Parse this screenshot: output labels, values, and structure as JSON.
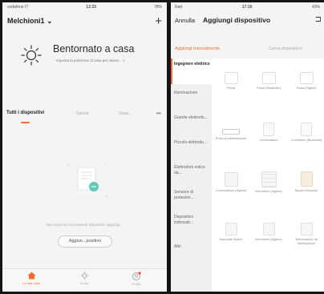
{
  "left": {
    "status": {
      "carrier": "vodafone IT",
      "time": "12:33",
      "battery": "78%"
    },
    "home_name": "Melchioni1 ⌄",
    "welcome_title": "Bentornato a casa",
    "welcome_sub": "Imposta la posizione di casa per ottene... >",
    "tabs": {
      "all": "Tutti i dispositivi",
      "room1": "Salone",
      "room2": "Stanz..."
    },
    "empty_text": "Non sono ancora presenti dispositivi, aggiungi...",
    "add_button": "Aggiun...positivo",
    "nav": [
      {
        "label": "La mia casa"
      },
      {
        "label": "Smart"
      },
      {
        "label": "Profilo"
      }
    ]
  },
  "right": {
    "status": {
      "carrier": "Iliad",
      "time": "17:16",
      "battery": "43%"
    },
    "cancel": "Annulla",
    "title": "Aggiungi dispositivo",
    "tabs": {
      "manual": "Aggiungi manualmente",
      "search": "Cerca dispositivo"
    },
    "categories": [
      "Ingegnere elettrico",
      "Illuminazione",
      "Grande elettrodo...",
      "Piccolo elettrodo...",
      "Elettrodom estico da...",
      "Sensore di protezion...",
      "Dispositivo indossab...",
      "Altri"
    ],
    "devices": [
      "Presa",
      "Presa (Bluetooth)",
      "Presa (Zigbee)",
      "Presa di alimentazione",
      "Commutatore",
      "Connettore (Bluetooth)",
      "Commutatore (Zigbee)",
      "Interruttore (Zigbee)",
      "Spazio Bluetooth",
      "Bracciale Switch",
      "Interruttore (Zigbee)",
      "Telecomando da illuminazione"
    ]
  },
  "colors": {
    "accent": "#ff6a2a"
  }
}
